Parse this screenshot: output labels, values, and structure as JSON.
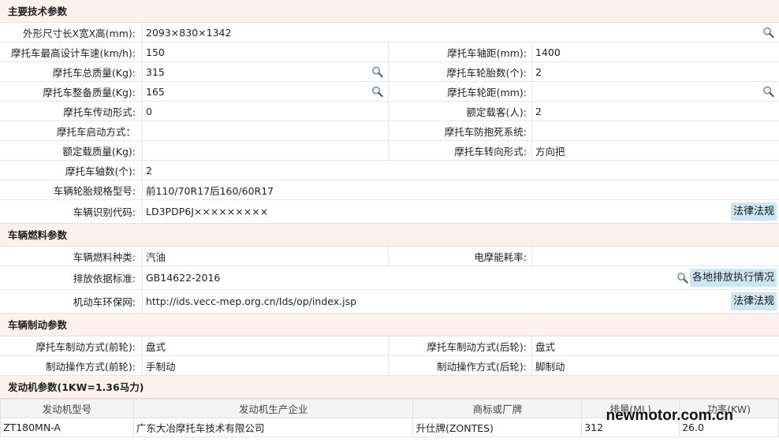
{
  "sections": {
    "main": "主要技术参数",
    "fuel": "车辆燃料参数",
    "brake": "车辆制动参数",
    "engine": "发动机参数(1KW=1.36马力)"
  },
  "main": {
    "dims_label": "外形尺寸长X宽X高(mm):",
    "dims_value": "2093×830×1342",
    "speed_label": "摩托车最高设计车速(km/h):",
    "speed_value": "150",
    "wheelbase_label": "摩托车轴距(mm):",
    "wheelbase_value": "1400",
    "gross_label": "摩托车总质量(Kg):",
    "gross_value": "315",
    "tires_label": "摩托车轮胎数(个):",
    "tires_value": "2",
    "curb_label": "摩托车整备质量(Kg):",
    "curb_value": "165",
    "track_label": "摩托车轮距(mm):",
    "track_value": "",
    "drive_label": "摩托车传动形式:",
    "drive_value": "0",
    "passengers_label": "额定载客(人):",
    "passengers_value": "2",
    "start_label": "摩托车启动方式：",
    "start_value": "",
    "abs_label": "摩托车防抱死系统:",
    "abs_value": "",
    "load_label": "额定载质量(Kg):",
    "load_value": "",
    "steer_label": "摩托车转向形式:",
    "steer_value": "方向把",
    "axles_label": "摩托车轴数(个):",
    "axles_value": "2",
    "tirespec_label": "车辆轮胎规格型号:",
    "tirespec_value": "前110/70R17后160/60R17",
    "vin_label": "车辆识别代码:",
    "vin_value": "LD3PDP6J×××××××××",
    "law_button": "法律法规"
  },
  "fuel": {
    "type_label": "车辆燃料种类:",
    "type_value": "汽油",
    "elec_label": "电摩能耗率:",
    "elec_value": "",
    "std_label": "排放依据标准:",
    "std_value": "GB14622-2016",
    "std_button": "各地排放执行情况",
    "env_label": "机动车环保网:",
    "env_value": "http://ids.vecc-mep.org.cn/Ids/op/index.jsp",
    "law_button": "法律法规"
  },
  "brake": {
    "front_label": "摩托车制动方式(前轮):",
    "front_value": "盘式",
    "rear_label": "摩托车制动方式(后轮):",
    "rear_value": "盘式",
    "op_front_label": "制动操作方式(前轮):",
    "op_front_value": "手制动",
    "op_rear_label": "制动操作方式(后轮):",
    "op_rear_value": "脚制动"
  },
  "engine": {
    "headers": [
      "发动机型号",
      "发动机生产企业",
      "商标或厂牌",
      "排量(ML)",
      "功率(KW)"
    ],
    "rows": [
      [
        "ZT180MN-A",
        "广东大冶摩托车技术有限公司",
        "升仕牌(ZONTES)",
        "312",
        "26.0"
      ]
    ]
  },
  "watermark": "newmotor.com.cn",
  "icons": {
    "magnifier": "search-icon"
  }
}
